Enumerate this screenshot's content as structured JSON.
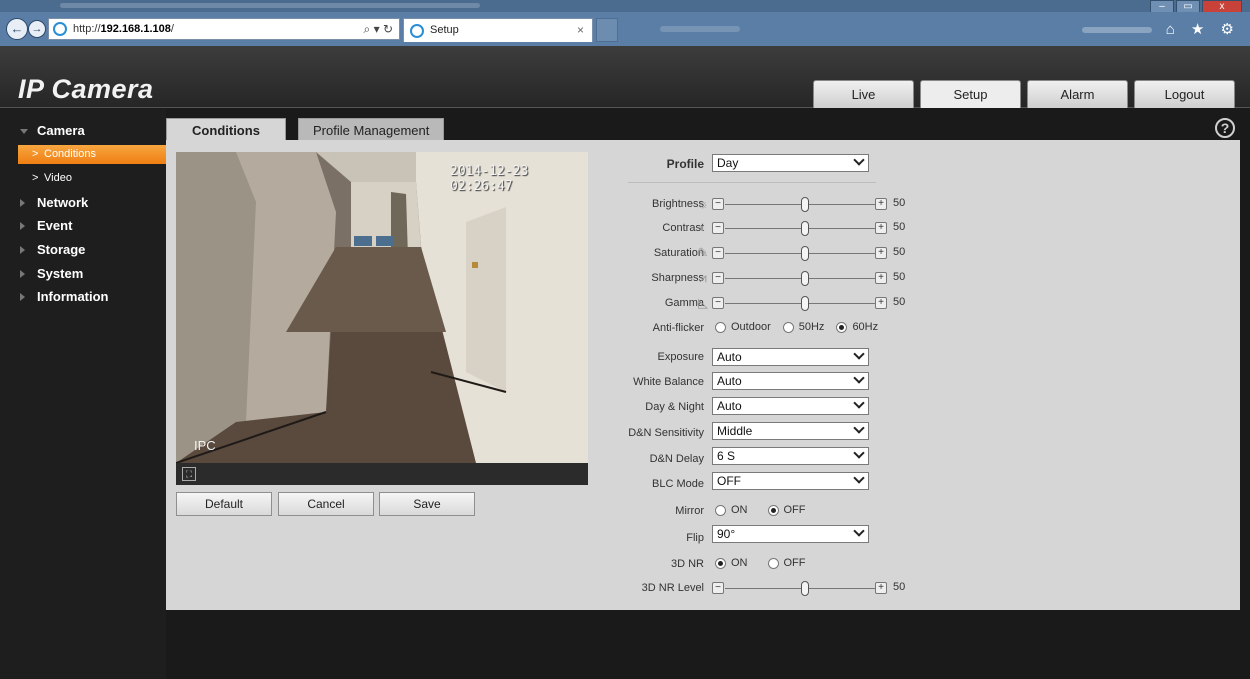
{
  "browser": {
    "url_prefix": "http://",
    "url_host": "192.168.1.108",
    "url_suffix": "/",
    "address_tools": "⌕ ▾ ↻",
    "tab_title": "Setup",
    "tab_close": "×",
    "back_glyph": "←",
    "forward_glyph": "→",
    "window_min": "–",
    "window_max": "▭",
    "window_close": "x",
    "right_icons": "⌂ ★ ⚙"
  },
  "app": {
    "logo": "IP Camera",
    "top_tabs": [
      {
        "label": "Live",
        "active": false
      },
      {
        "label": "Setup",
        "active": true
      },
      {
        "label": "Alarm",
        "active": false
      },
      {
        "label": "Logout",
        "active": false
      }
    ]
  },
  "sidebar": {
    "camera": "Camera",
    "conditions": "Conditions",
    "video": "Video",
    "network": "Network",
    "event": "Event",
    "storage": "Storage",
    "system": "System",
    "information": "Information",
    "chevron": ">"
  },
  "content_tabs": {
    "conditions": "Conditions",
    "profile_management": "Profile Management",
    "help": "?"
  },
  "preview": {
    "timestamp": "2014-12-23 02:26:47",
    "channel_name": "IPC",
    "fullscreen_glyph": "⛶"
  },
  "buttons": {
    "default": "Default",
    "cancel": "Cancel",
    "save": "Save"
  },
  "form": {
    "profile_label": "Profile",
    "profile_value": "Day",
    "brightness_label": "Brightness",
    "brightness_value": 50,
    "contrast_label": "Contrast",
    "contrast_value": 50,
    "saturation_label": "Saturation",
    "saturation_value": 50,
    "sharpness_label": "Sharpness",
    "sharpness_value": 50,
    "gamma_label": "Gamma",
    "gamma_value": 50,
    "antiflicker_label": "Anti-flicker",
    "antiflicker_options": [
      "Outdoor",
      "50Hz",
      "60Hz"
    ],
    "antiflicker_selected": "60Hz",
    "exposure_label": "Exposure",
    "exposure_value": "Auto",
    "white_balance_label": "White Balance",
    "white_balance_value": "Auto",
    "day_night_label": "Day & Night",
    "day_night_value": "Auto",
    "dn_sensitivity_label": "D&N Sensitivity",
    "dn_sensitivity_value": "Middle",
    "dn_delay_label": "D&N Delay",
    "dn_delay_value": "6 S",
    "blc_label": "BLC Mode",
    "blc_value": "OFF",
    "mirror_label": "Mirror",
    "mirror_options": [
      "ON",
      "OFF"
    ],
    "mirror_selected": "OFF",
    "flip_label": "Flip",
    "flip_value": "90°",
    "nr3d_label": "3D NR",
    "nr3d_options": [
      "ON",
      "OFF"
    ],
    "nr3d_selected": "ON",
    "nr3d_level_label": "3D NR Level",
    "nr3d_level_value": 50,
    "minus_glyph": "−",
    "plus_glyph": "+"
  },
  "colors": {
    "accent_orange": "#ef7f12",
    "panel_gray": "#d6d6d6",
    "sidebar_bg": "#1e1e1e"
  }
}
